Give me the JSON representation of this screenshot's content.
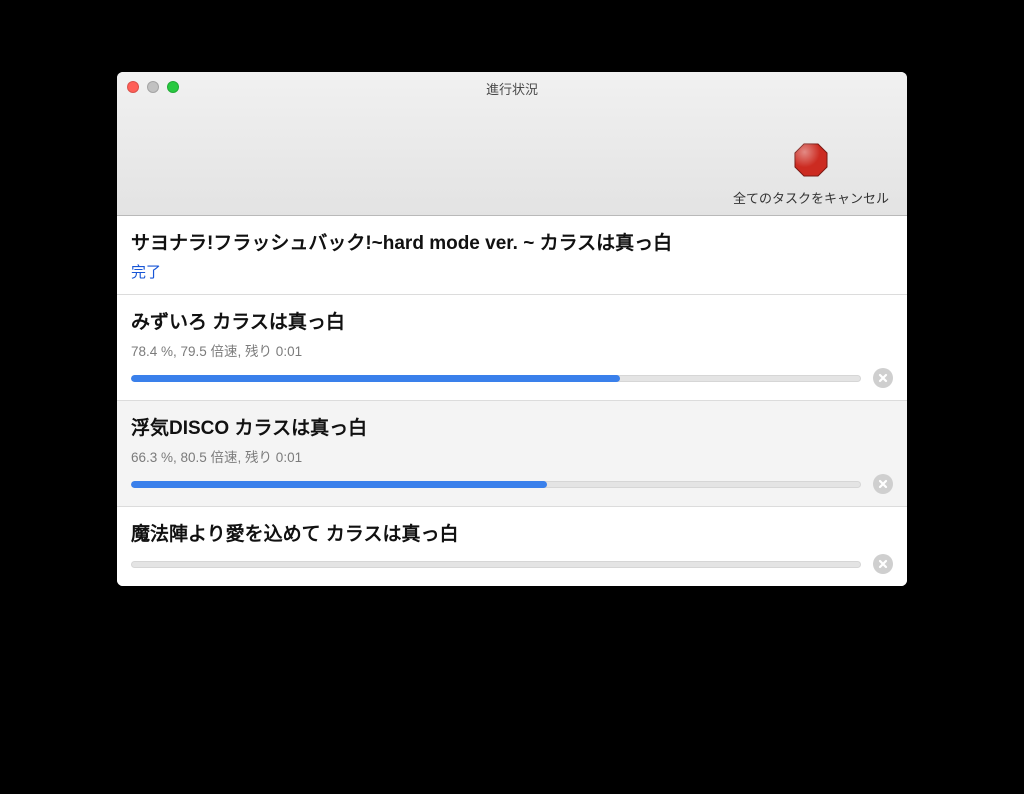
{
  "window": {
    "title": "進行状況"
  },
  "toolbar": {
    "cancel_all_label": "全てのタスクをキャンセル"
  },
  "tasks": [
    {
      "title": "サヨナラ!フラッシュバック!~hard mode ver. ~ カラスは真っ白",
      "done_label": "完了",
      "done": true
    },
    {
      "title": "みずいろ カラスは真っ白",
      "status": "78.4 %, 79.5 倍速, 残り 0:01",
      "progress_percent": 67
    },
    {
      "title": "浮気DISCO カラスは真っ白",
      "status": "66.3 %, 80.5 倍速, 残り 0:01",
      "progress_percent": 57
    },
    {
      "title": "魔法陣より愛を込めて カラスは真っ白",
      "status": "",
      "progress_percent": 0
    }
  ]
}
